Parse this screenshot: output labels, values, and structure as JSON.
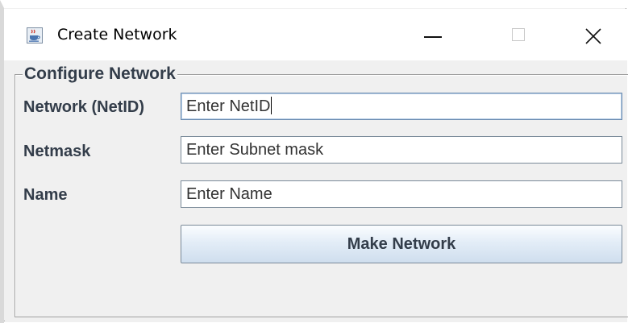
{
  "window": {
    "title": "Create Network",
    "icon": "java-cup-icon",
    "controls": {
      "minimize_icon": "minimize-icon",
      "maximize_icon": "maximize-icon",
      "close_icon": "close-icon"
    }
  },
  "form": {
    "group_title": "Configure Network",
    "fields": [
      {
        "label": "Network (NetID)",
        "value": "Enter NetID",
        "focused": true
      },
      {
        "label": "Netmask",
        "value": "Enter Subnet mask"
      },
      {
        "label": "Name",
        "value": "Enter Name"
      }
    ],
    "submit_label": "Make Network"
  },
  "colors": {
    "label_text": "#333d4a",
    "button_gradient_top": "#fbfdff",
    "button_gradient_bottom": "#cfdeee",
    "field_border": "#7a8a99"
  }
}
